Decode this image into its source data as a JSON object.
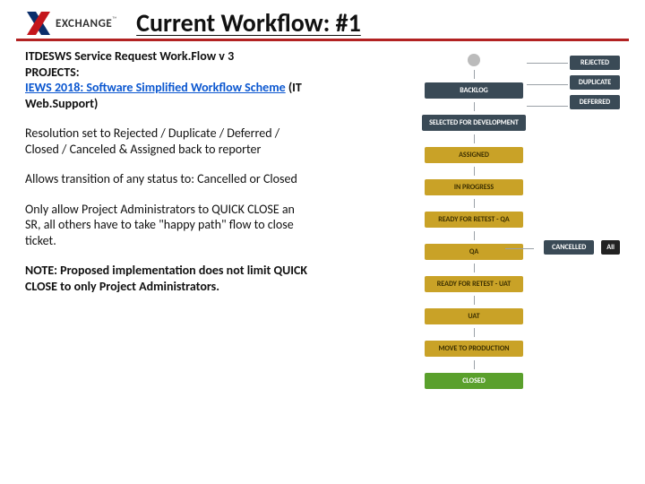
{
  "header": {
    "logo_text": "EXCHANGE",
    "logo_tm": "™",
    "title": "Current Workflow: #1"
  },
  "left": {
    "line1": "ITDESWS Service Request Work.Flow v 3",
    "line2": "PROJECTS:",
    "link_text": "IEWS 2018: Software Simplified Workflow Scheme",
    "link_suffix": " (IT Web.Support)",
    "p2": "Resolution set to Rejected / Duplicate / Deferred / Closed / Canceled & Assigned back to reporter",
    "p3": "Allows transition of any status to: Cancelled or Closed",
    "p4": "Only allow Project Administrators to QUICK CLOSE an SR, all others have to take \"happy path\" flow to close ticket.",
    "p5": "NOTE: Proposed implementation does not limit QUICK CLOSE to only Project Administrators."
  },
  "flow": {
    "backlog": "BACKLOG",
    "selected": "SELECTED FOR DEVELOPMENT",
    "assigned": "ASSIGNED",
    "inprogress": "IN PROGRESS",
    "ready_qa": "READY FOR RETEST - QA",
    "qa": "QA",
    "ready_uat": "READY FOR RETEST - UAT",
    "uat": "UAT",
    "move_prod": "MOVE TO PRODUCTION",
    "closed": "CLOSED"
  },
  "side": {
    "rejected": "REJECTED",
    "duplicate": "DUPLICATE",
    "deferred": "DEFERRED",
    "cancelled": "CANCELLED",
    "all": "All"
  }
}
